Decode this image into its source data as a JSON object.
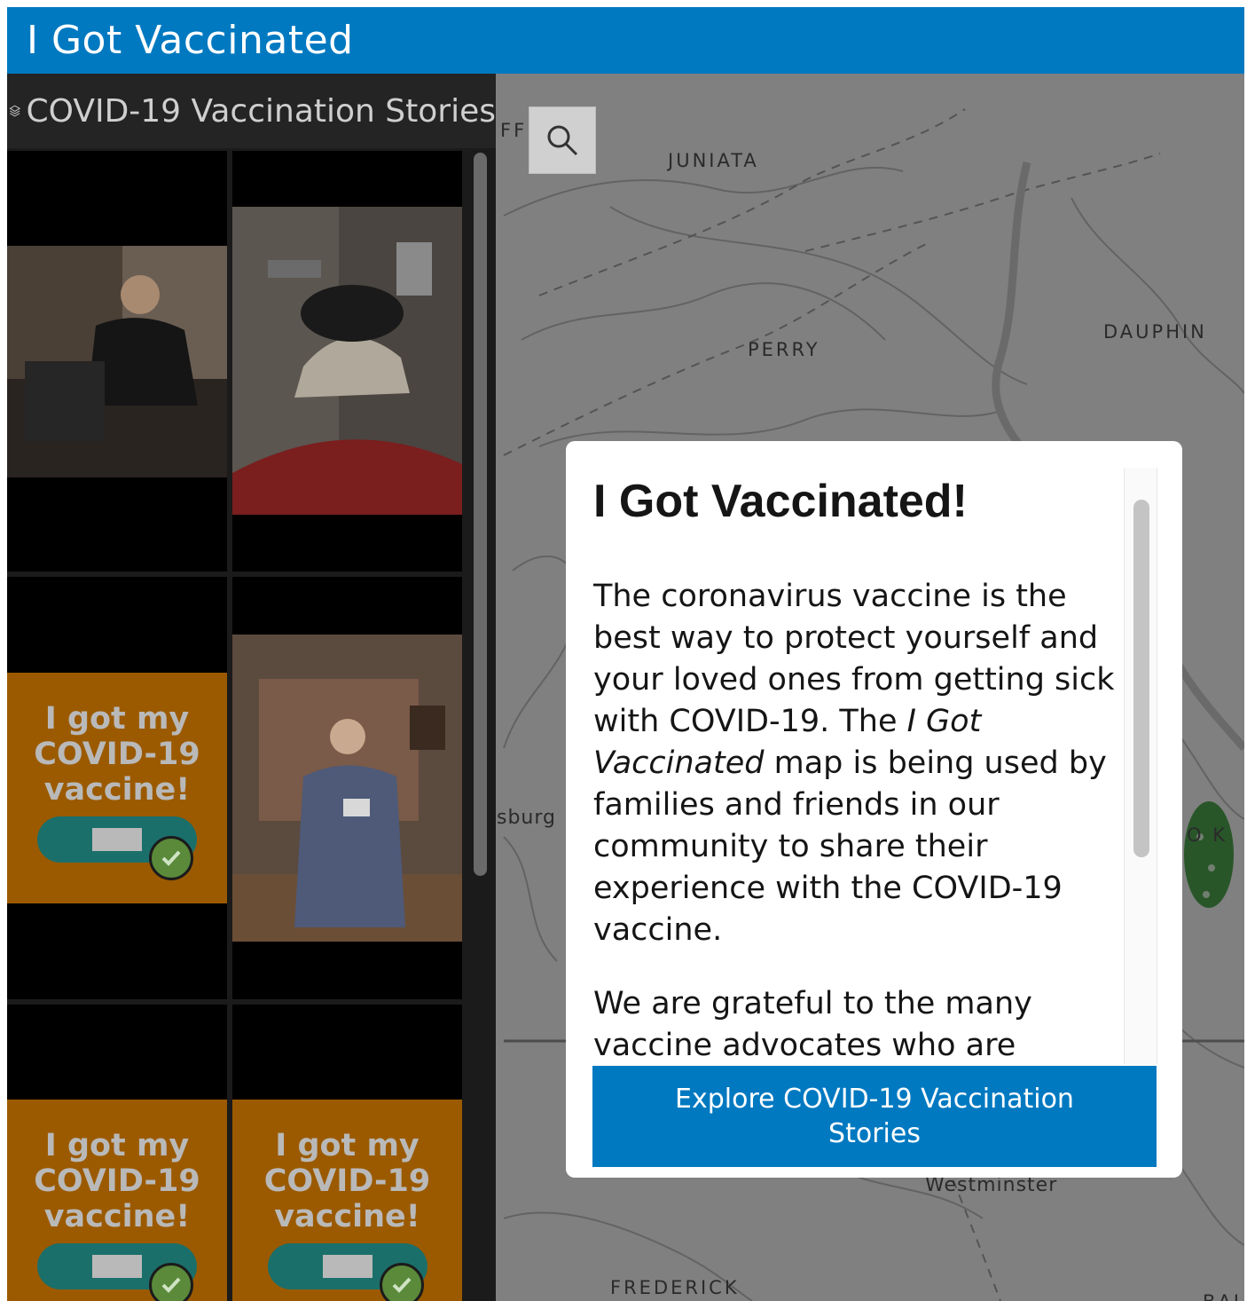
{
  "header": {
    "title": "I Got Vaccinated"
  },
  "panel": {
    "title": "COVID-19 Vaccination Stories",
    "layers_icon": "layers-icon",
    "cards": [
      {
        "type": "photo"
      },
      {
        "type": "photo"
      },
      {
        "type": "graphic",
        "lines": [
          "I got my",
          "COVID-19",
          "vaccine!"
        ]
      },
      {
        "type": "photo"
      },
      {
        "type": "graphic",
        "lines": [
          "I got my",
          "COVID-19",
          "vaccine!"
        ]
      },
      {
        "type": "graphic",
        "lines": [
          "I got my",
          "COVID-19",
          "vaccine!"
        ]
      }
    ]
  },
  "map": {
    "search_icon": "search-icon",
    "labels": {
      "juniata": "JUNIATA",
      "perry": "PERRY",
      "dauphin": "DAUPHIN",
      "burg": "sburg",
      "westminster": "Westminster",
      "frederick": "FREDERICK",
      "ffl": "FFL",
      "york": "O K",
      "bal": "BAL"
    }
  },
  "modal": {
    "title": "I Got Vaccinated!",
    "p1_a": "The coronavirus vaccine is the best way to protect yourself and your loved ones from getting sick with COVID-19. The ",
    "p1_em": "I Got Vaccinated",
    "p1_b": " map is being used by families and friends in our community to share their experience with the COVID-19 vaccine.",
    "p2": "We are grateful to the many vaccine advocates who are willing to share their stories.",
    "button_label": "Explore COVID-19 Vaccination Stories"
  },
  "colors": {
    "brand_blue": "#0079c1",
    "panel_header": "#242424",
    "vax_orange": "#9b5a00",
    "pill_teal": "#1b6f6a",
    "check_green": "#5b8a3a"
  }
}
